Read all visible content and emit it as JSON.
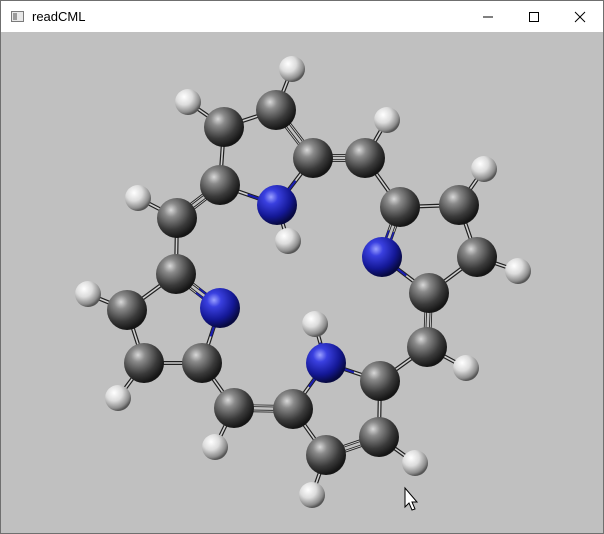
{
  "window": {
    "title": "readCML"
  },
  "controls": {
    "minimize_icon": "minimize-icon",
    "maximize_icon": "maximize-icon",
    "close_icon": "close-icon"
  },
  "viewer": {
    "background": "#c0c0c0",
    "carbon_color": "#3c3c3c",
    "nitrogen_color": "#1b1fb0",
    "hydrogen_color": "#d9d9d9",
    "cursor": "arrow-cursor"
  }
}
